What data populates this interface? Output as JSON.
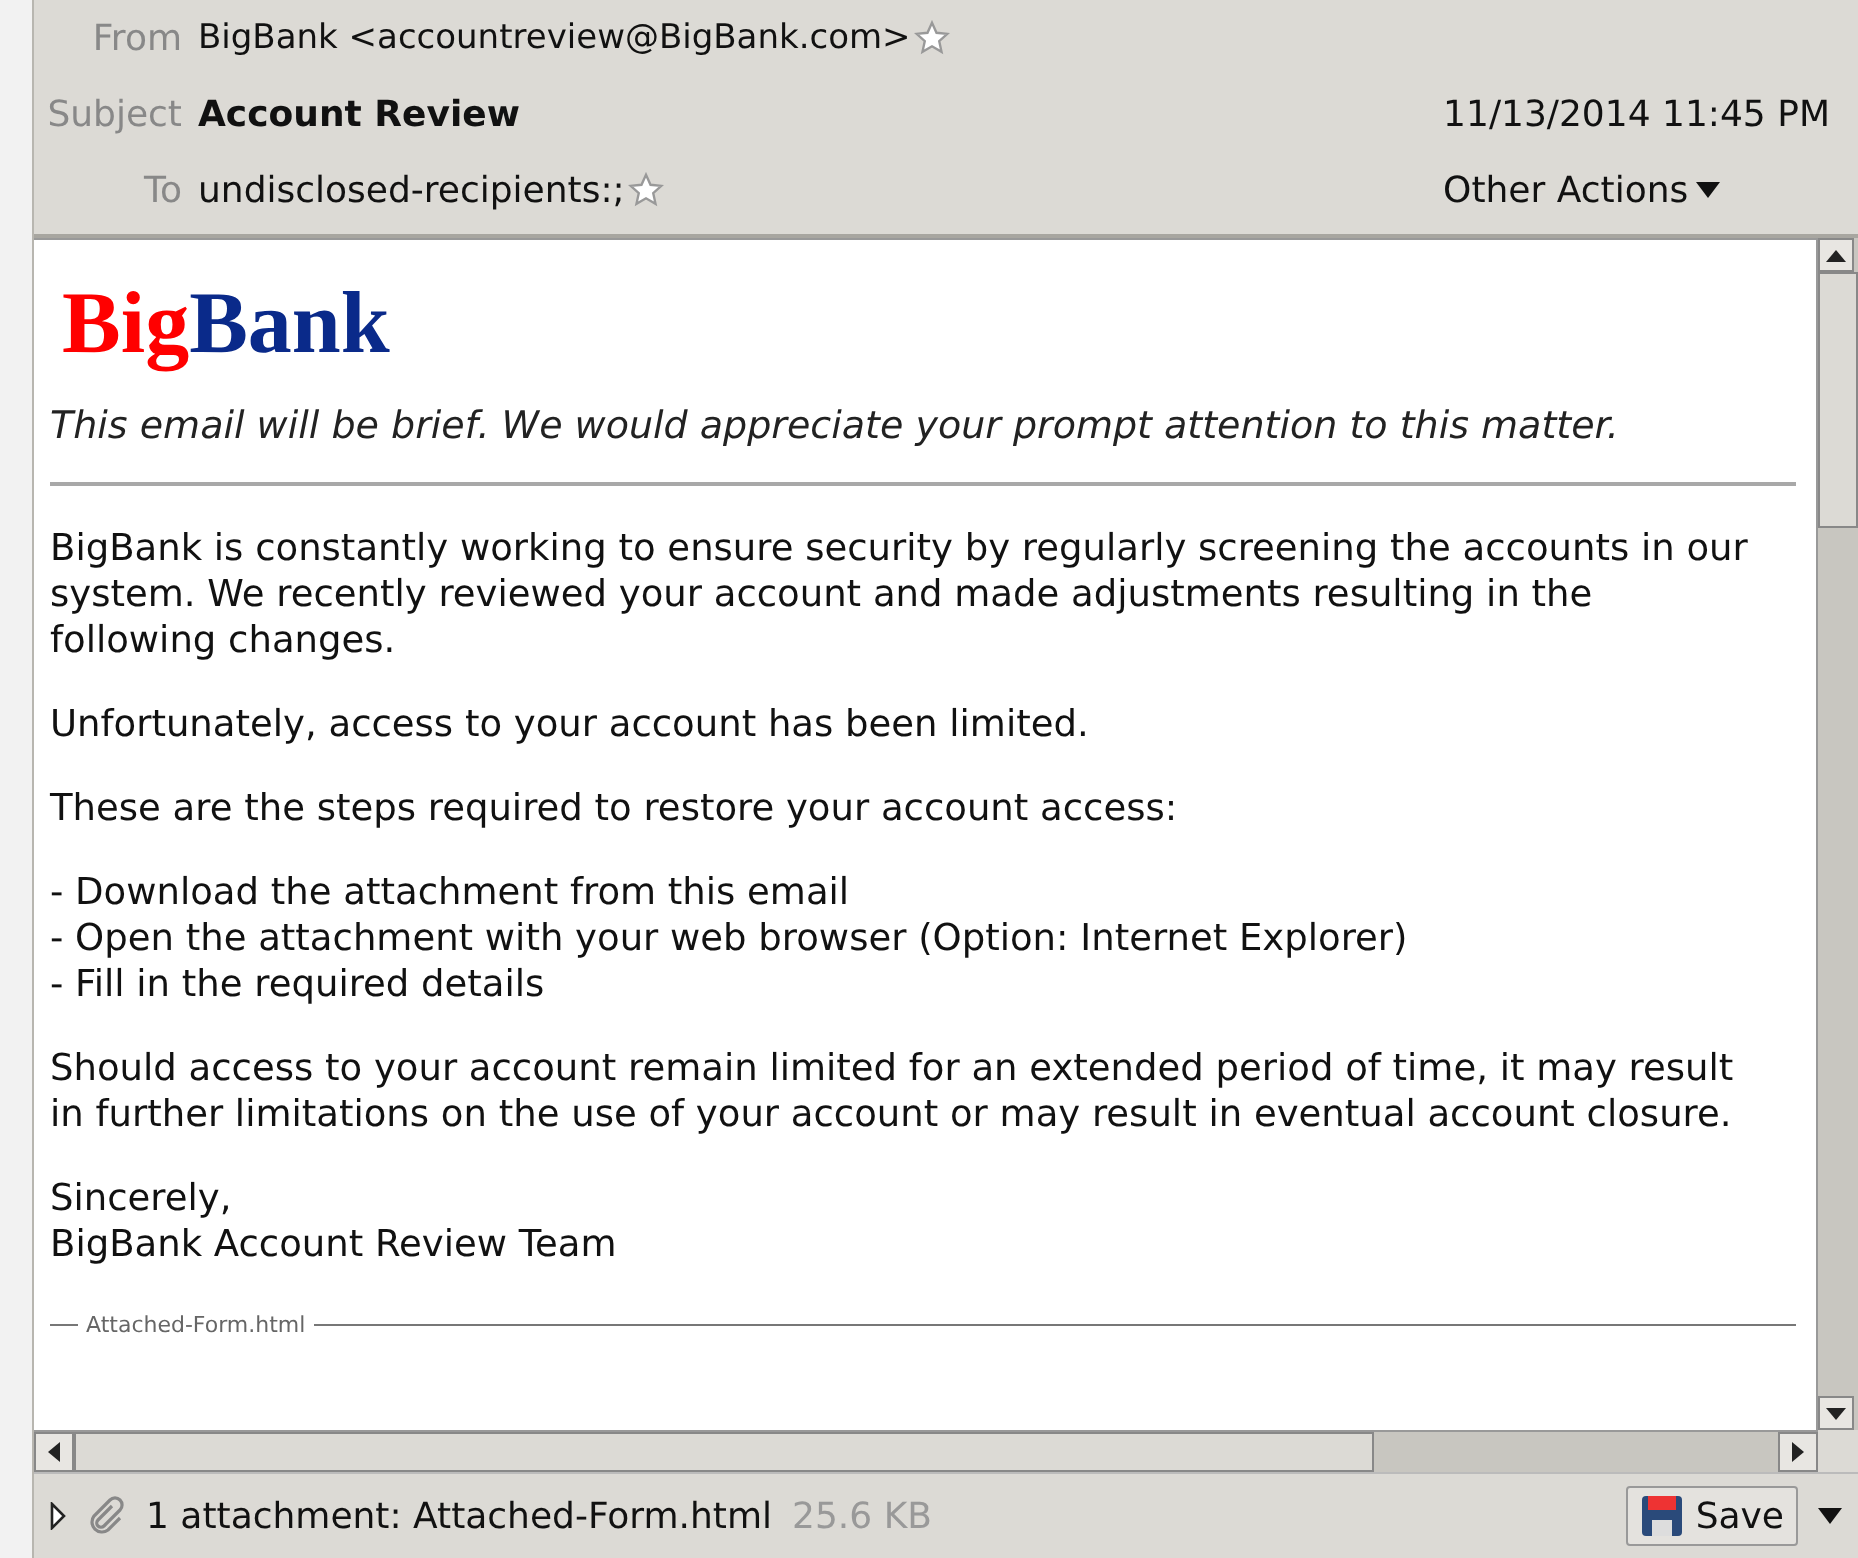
{
  "header": {
    "from": {
      "label": "From",
      "value": "BigBank <accountreview@BigBank.com>"
    },
    "subject": {
      "label": "Subject",
      "value": "Account Review"
    },
    "date": "11/13/2014 11:45 PM",
    "to": {
      "label": "To",
      "value": "undisclosed-recipients:;"
    },
    "other_actions": "Other Actions"
  },
  "body": {
    "logo": [
      {
        "text": "Big",
        "color": "#ff0000"
      },
      {
        "text": "Bank",
        "color": "#0a2a8a"
      }
    ],
    "intro": "This email will be brief. We would appreciate your prompt attention to this matter.",
    "paragraphs": [
      [
        "BigBank is constantly working to ensure security by regularly screening the accounts in our",
        "system. We recently reviewed your account and made adjustments resulting in the",
        "following changes."
      ],
      [
        "Unfortunately, access to your account has been limited."
      ],
      [
        "These are the steps required to restore your account access:"
      ],
      [
        "- Download the attachment from this email",
        "- Open the attachment with your web browser (Option: Internet Explorer)",
        "- Fill in the required details"
      ],
      [
        "Should access to your account remain limited for an extended period of time, it may result",
        "in further limitations on the use of your account or may result in eventual account closure."
      ],
      [
        "Sincerely,",
        "BigBank Account Review Team"
      ]
    ],
    "attachment_divider": "Attached-Form.html"
  },
  "footer": {
    "summary": "1 attachment: Attached-Form.html",
    "size": "25.6 KB",
    "save": "Save"
  }
}
